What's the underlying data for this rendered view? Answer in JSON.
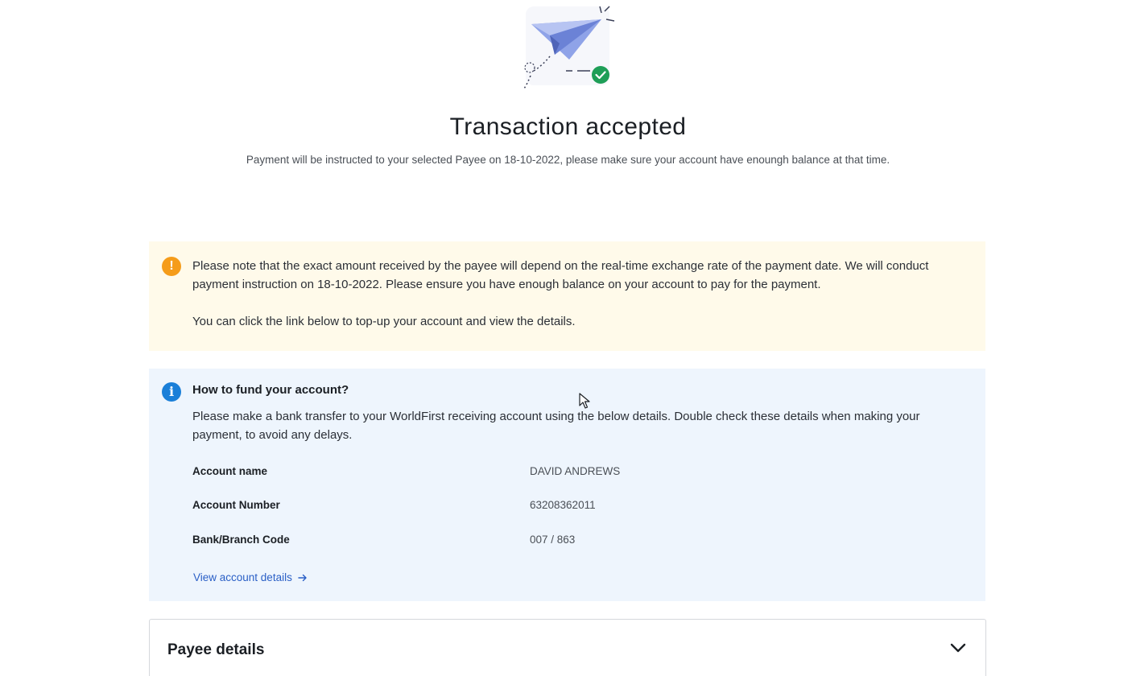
{
  "hero": {
    "illustration_icon": "paper-plane-success-icon"
  },
  "title": "Transaction accepted",
  "subtitle": "Payment will be instructed to your selected Payee on 18-10-2022, please make sure your account have enoungh balance at that time.",
  "warning_notice": {
    "icon": "exclamation-icon",
    "icon_glyph": "!",
    "paragraph_1": "Please note that the exact amount received by the payee will depend on the real-time exchange rate of the payment date. We will conduct payment instruction on 18-10-2022. Please ensure you have enough balance on your account to pay for the payment.",
    "paragraph_2": "You can click the link below to top-up your account and view the details.",
    "background": "#fffaea",
    "icon_color": "#f59c1a"
  },
  "info_notice": {
    "icon": "info-icon",
    "icon_glyph": "i",
    "heading": "How to fund your account?",
    "body": "Please make a bank transfer to your WorldFirst receiving account using the below details. Double check these details when making your payment, to avoid any delays.",
    "details": [
      {
        "label": "Account name",
        "value": "DAVID ANDREWS"
      },
      {
        "label": "Account Number",
        "value": "63208362011"
      },
      {
        "label": "Bank/Branch Code",
        "value": "007 / 863"
      }
    ],
    "link_label": "View account details",
    "background": "#eef5fd",
    "icon_color": "#1a7fd8",
    "link_color": "#2a5fc6"
  },
  "payee_section": {
    "title": "Payee details",
    "expand_icon": "chevron-down-icon"
  },
  "accent_color": "#2a5fc6",
  "success_color": "#1e9e57"
}
